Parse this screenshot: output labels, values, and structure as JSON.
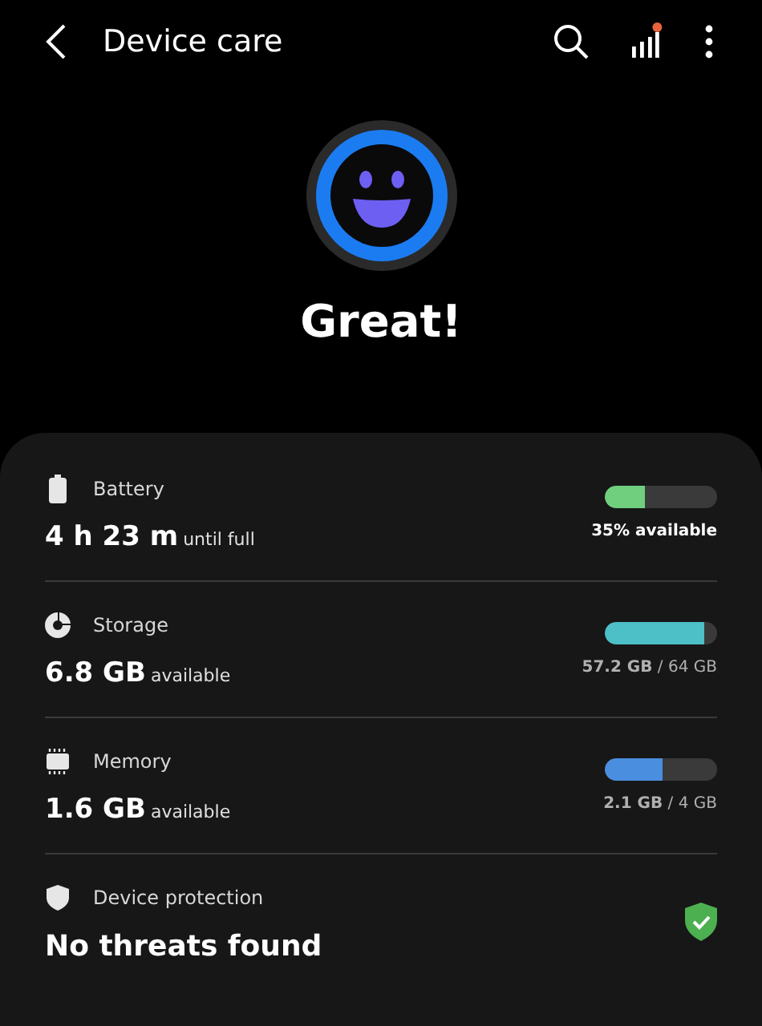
{
  "header": {
    "title": "Device care"
  },
  "status": {
    "text": "Great!"
  },
  "items": [
    {
      "kind": "battery",
      "label": "Battery",
      "value": "4 h 23 m",
      "unit": "until full",
      "level": 0.35,
      "color": "#6fcf7f",
      "reading": "35% available"
    },
    {
      "kind": "storage",
      "label": "Storage",
      "value": "6.8 GB",
      "unit": "available",
      "level": 0.89,
      "color": "#4dbfc6",
      "reading": "**57.2 GB** / 64 GB"
    },
    {
      "kind": "memory",
      "label": "Memory",
      "value": "1.6 GB",
      "unit": "available",
      "level": 0.52,
      "color": "#4a8ee0",
      "reading": "**2.1 GB** / 4 GB"
    },
    {
      "kind": "protection",
      "label": "Device protection",
      "value": "No threats found"
    }
  ]
}
